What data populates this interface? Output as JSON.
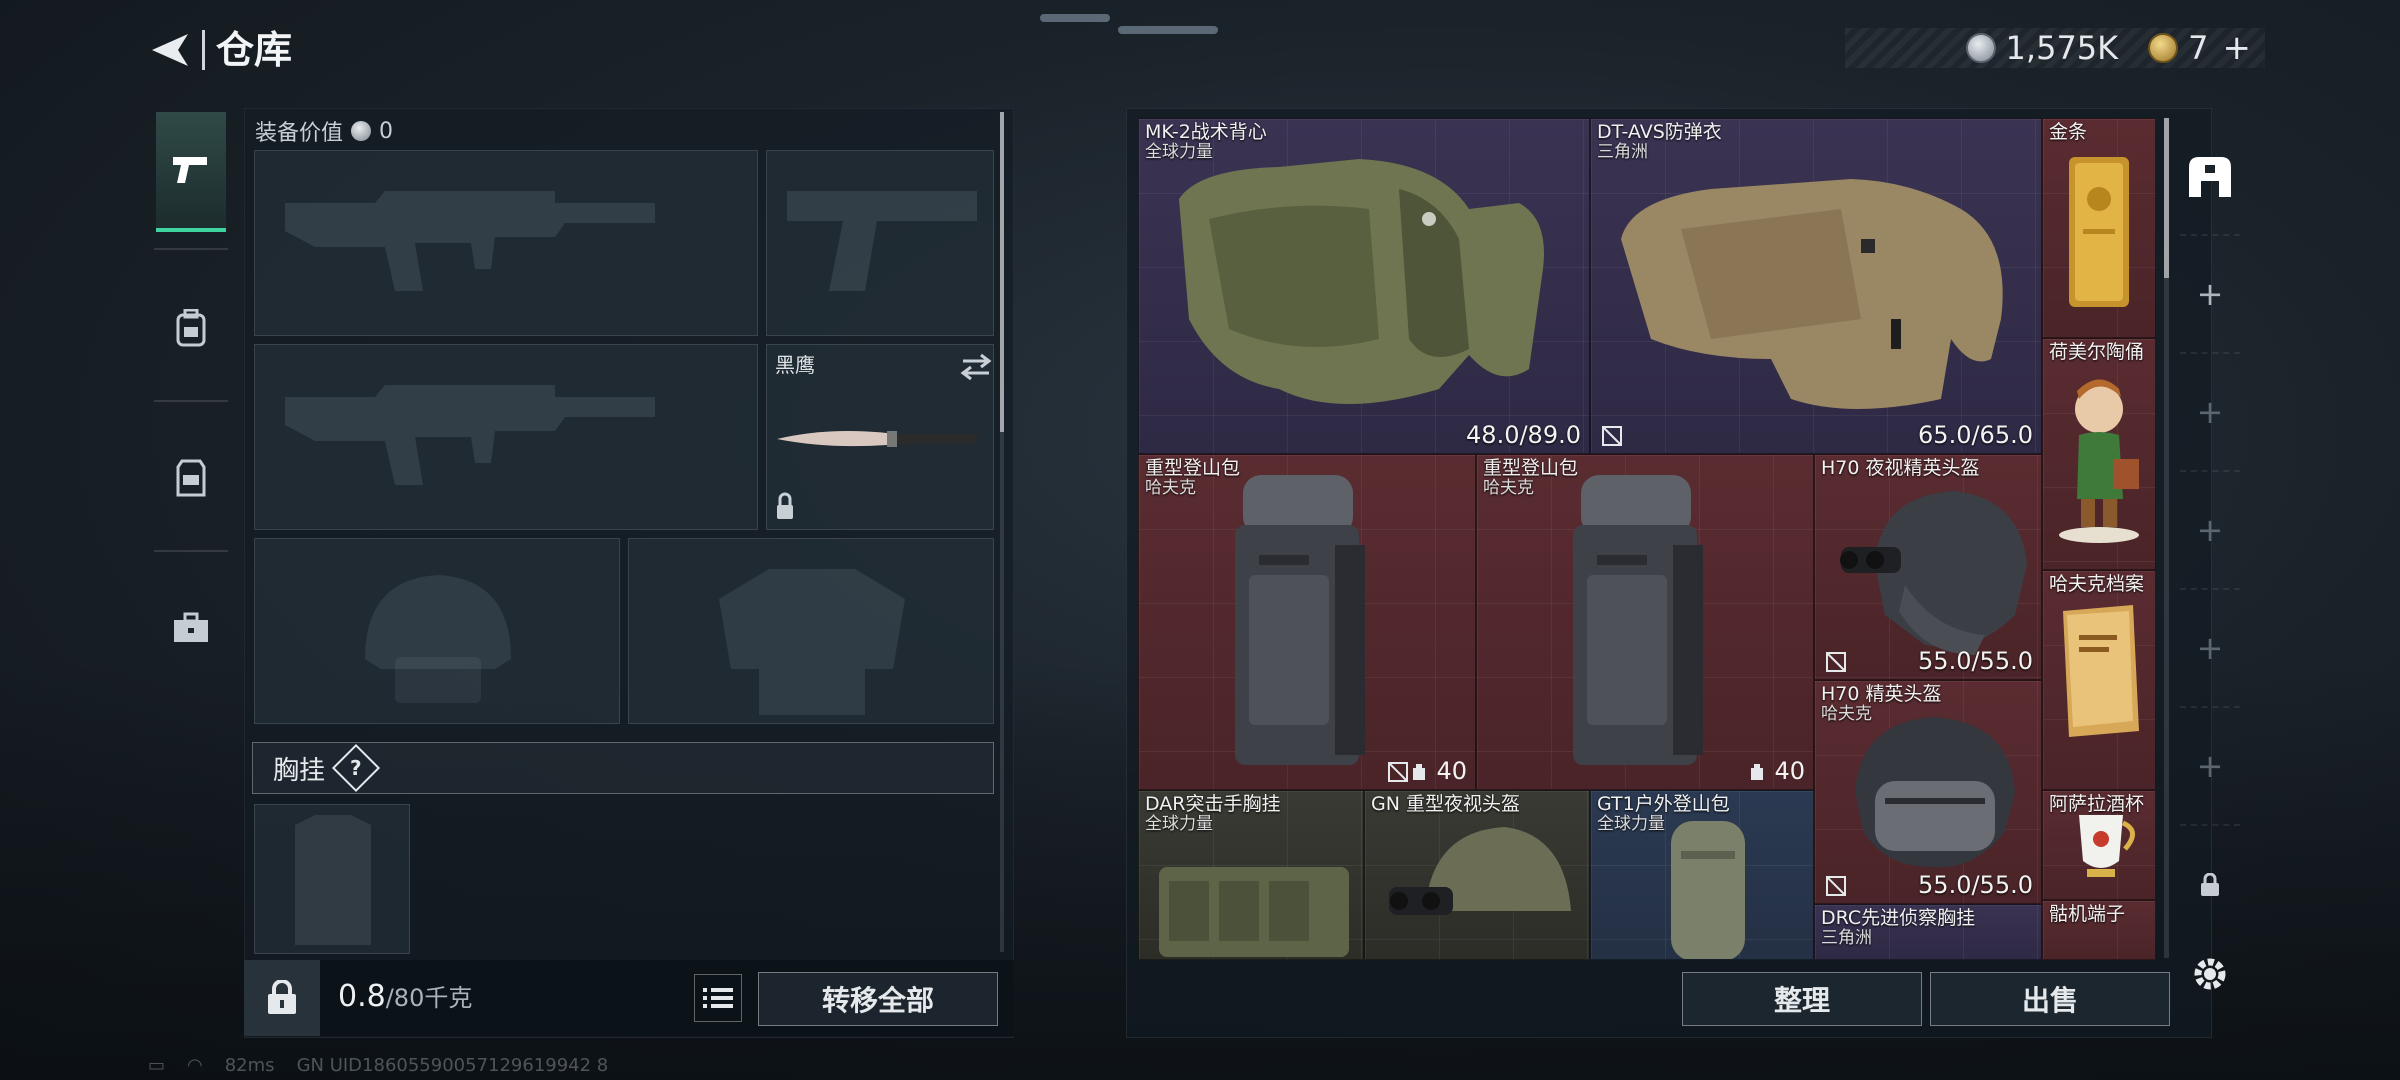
{
  "header": {
    "title": "仓库"
  },
  "currency": [
    {
      "icon": "silver-coin-icon",
      "value": "1,575K"
    },
    {
      "icon": "gold-coin-icon",
      "value": "7"
    }
  ],
  "left_tabs": [
    "pistol-icon",
    "backpack-icon",
    "chest-rig-icon",
    "toolbox-icon"
  ],
  "loadout": {
    "equip_value_label": "装备价值",
    "equip_value": "0",
    "melee_name": "黑鹰",
    "chest_rig_label": "胸挂",
    "help_label": "?",
    "weight_current": "0.8",
    "weight_max": "/80千克",
    "transfer_all_label": "转移全部"
  },
  "stash_items": [
    {
      "name": "MK-2战术背心",
      "sub": "全球力量",
      "durability": "48.0/89.0"
    },
    {
      "name": "DT-AVS防弹衣",
      "sub": "三角洲",
      "durability": "65.0/65.0"
    },
    {
      "name": "金条",
      "sub": ""
    },
    {
      "name": "荷美尔陶俑",
      "sub": ""
    },
    {
      "name": "重型登山包",
      "sub": "哈夫克",
      "capacity": "40"
    },
    {
      "name": "重型登山包",
      "sub": "哈夫克",
      "capacity": "40"
    },
    {
      "name": "H70 夜视精英头盔",
      "sub": "",
      "durability": "55.0/55.0"
    },
    {
      "name": "哈夫克档案",
      "sub": ""
    },
    {
      "name": "H70 精英头盔",
      "sub": "哈夫克",
      "durability": "55.0/55.0"
    },
    {
      "name": "DAR突击手胸挂",
      "sub": "全球力量"
    },
    {
      "name": "GN 重型夜视头盔",
      "sub": ""
    },
    {
      "name": "GT1户外登山包",
      "sub": "全球力量"
    },
    {
      "name": "阿萨拉酒杯",
      "sub": ""
    },
    {
      "name": "DRC先进侦察胸挂",
      "sub": "三角洲"
    },
    {
      "name": "骷机端子",
      "sub": ""
    }
  ],
  "stash_actions": {
    "sort_label": "整理",
    "sell_label": "出售"
  },
  "status_bar": {
    "ping": "82ms",
    "uid": "GN UID18605590057129619942 8"
  }
}
